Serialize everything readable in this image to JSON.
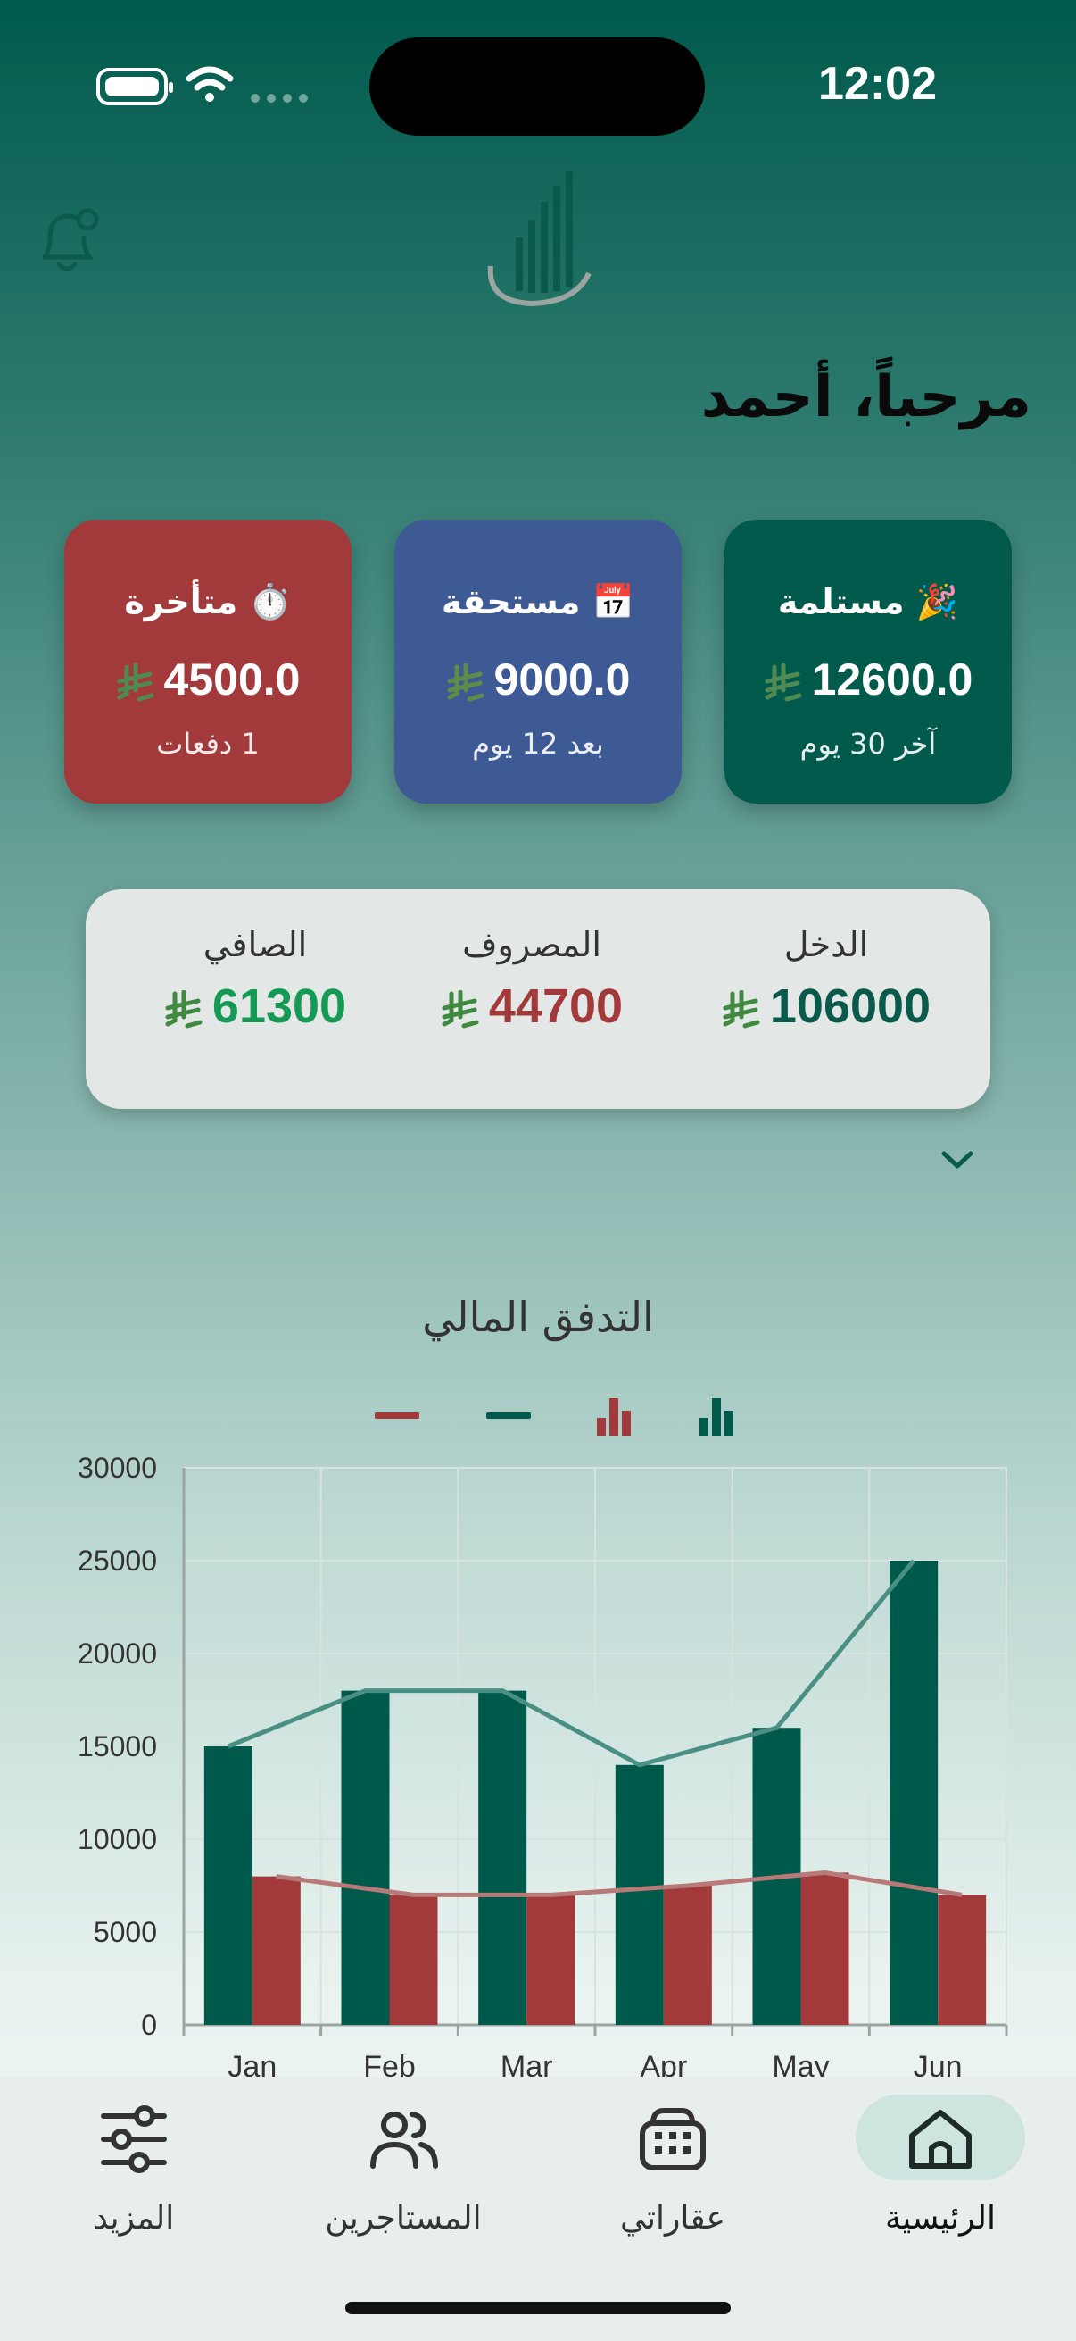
{
  "status_bar": {
    "time": "12:02"
  },
  "header": {
    "greeting": "مرحباً، أحمد"
  },
  "cards": {
    "late": {
      "title": "⏱️ متأخرة",
      "amount": "4500.0",
      "sub": "1 دفعات",
      "color": "#a23a3c"
    },
    "due": {
      "title": "📅 مستحقة",
      "amount": "9000.0",
      "sub": "بعد 12 يوم",
      "color": "#3d5a95"
    },
    "received": {
      "title": "🎉 مستلمة",
      "amount": "12600.0",
      "sub": "آخر 30 يوم",
      "color": "#015a4b"
    }
  },
  "summary": {
    "income": {
      "label": "الدخل",
      "value": "106000"
    },
    "expense": {
      "label": "المصروف",
      "value": "44700"
    },
    "net": {
      "label": "الصافي",
      "value": "61300"
    }
  },
  "chart_data": {
    "type": "bar",
    "title": "التدفق المالي",
    "categories": [
      "Jan",
      "Feb",
      "Mar",
      "Apr",
      "May",
      "Jun"
    ],
    "series": [
      {
        "values": [
          15000,
          18000,
          18000,
          14000,
          16000,
          25000
        ],
        "color": "#005a4b",
        "kind": "bar"
      },
      {
        "values": [
          8000,
          7000,
          7000,
          7500,
          8200,
          7000
        ],
        "color": "#a23a3c",
        "kind": "bar"
      },
      {
        "values": [
          15000,
          18000,
          18000,
          14000,
          16000,
          25000
        ],
        "color": "#4a8f84",
        "kind": "line"
      },
      {
        "values": [
          8000,
          7000,
          7000,
          7500,
          8200,
          7000
        ],
        "color": "#b87a78",
        "kind": "line"
      }
    ],
    "yticks": [
      0,
      5000,
      10000,
      15000,
      20000,
      25000,
      30000
    ],
    "ylim": [
      0,
      30000
    ],
    "grid": true
  },
  "tabs": [
    {
      "id": "home",
      "label": "الرئيسية",
      "icon": "home-icon",
      "active": true
    },
    {
      "id": "properties",
      "label": "عقاراتي",
      "icon": "building-icon",
      "active": false
    },
    {
      "id": "tenants",
      "label": "المستاجرين",
      "icon": "users-icon",
      "active": false
    },
    {
      "id": "more",
      "label": "المزيد",
      "icon": "sliders-icon",
      "active": false
    }
  ],
  "colors": {
    "brand": "#005a4b",
    "late": "#a23a3c",
    "due": "#3d5a95",
    "net": "#159a55"
  }
}
